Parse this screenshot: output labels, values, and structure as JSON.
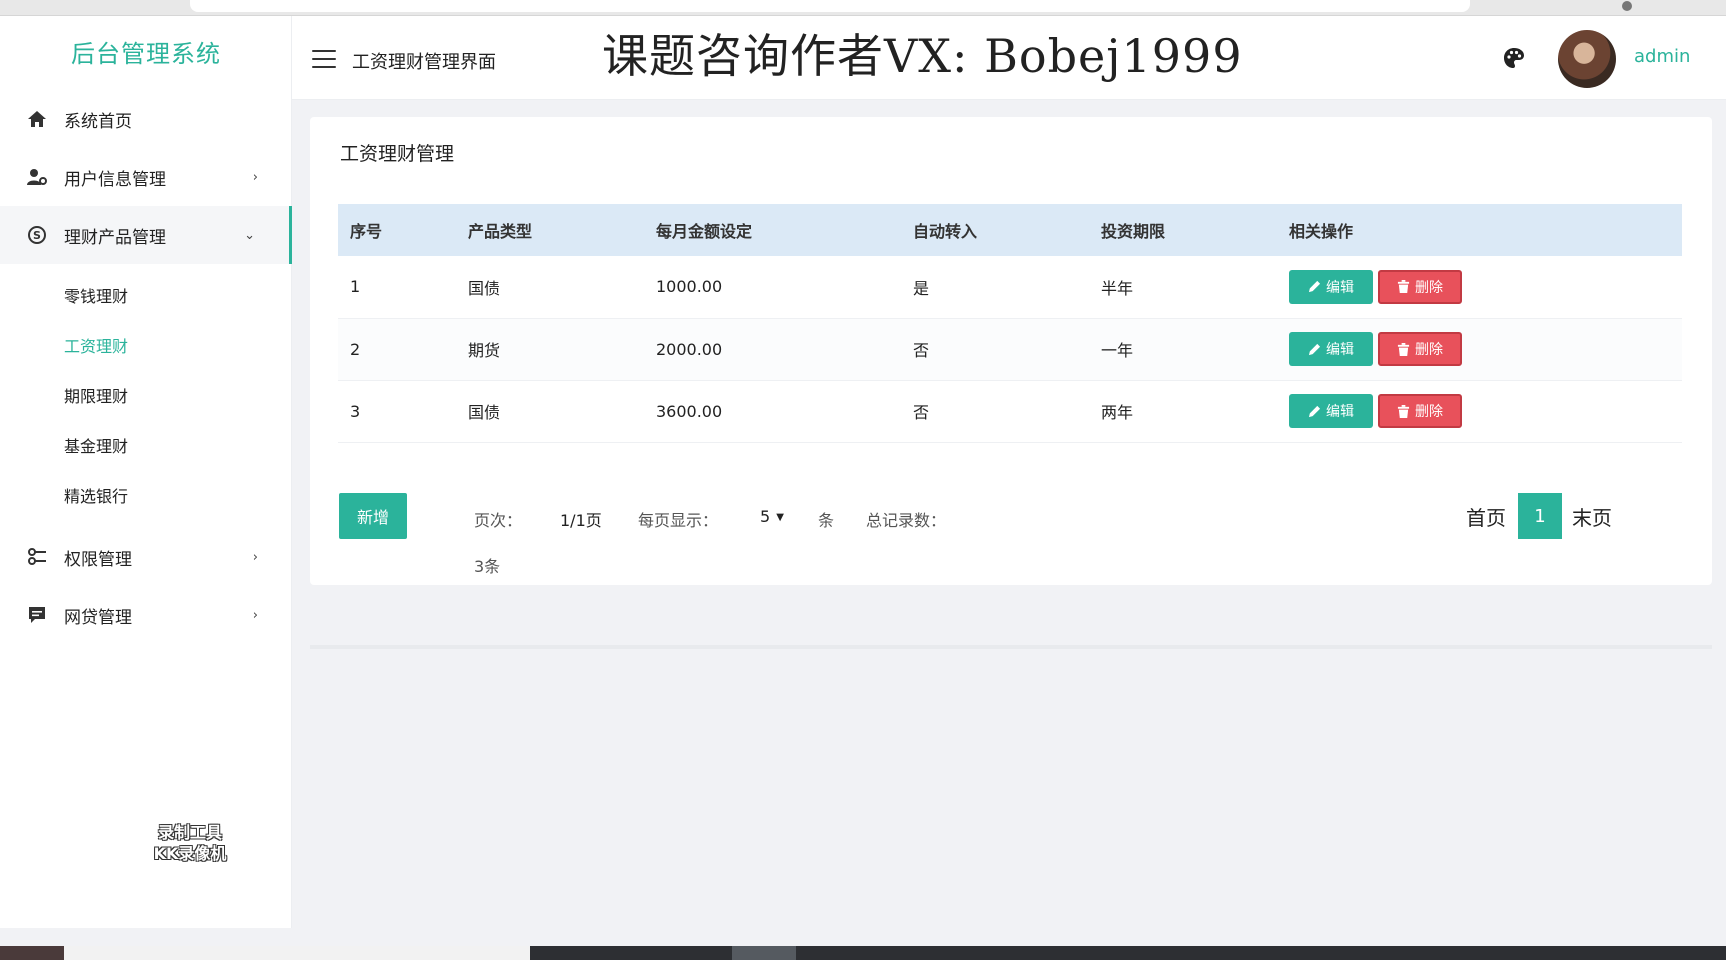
{
  "app": {
    "brand": "后台管理系统"
  },
  "sidebar": {
    "items": [
      {
        "label": "系统首页",
        "icon": "home-icon"
      },
      {
        "label": "用户信息管理",
        "icon": "user-settings-icon"
      },
      {
        "label": "理财产品管理",
        "icon": "skype-icon"
      },
      {
        "label": "权限管理",
        "icon": "key-icon"
      },
      {
        "label": "网贷管理",
        "icon": "message-icon"
      }
    ],
    "submenu": [
      {
        "label": "零钱理财"
      },
      {
        "label": "工资理财"
      },
      {
        "label": "期限理财"
      },
      {
        "label": "基金理财"
      },
      {
        "label": "精选银行"
      }
    ],
    "recorder_mark": {
      "line1": "录制工具",
      "line2": "KK录像机"
    }
  },
  "header": {
    "title": "工资理财管理界面",
    "watermark": "课题咨询作者VX: Bobej1999",
    "username": "admin",
    "accent": "#2bb39b"
  },
  "main": {
    "card_title": "工资理财管理",
    "table": {
      "columns": [
        "序号",
        "产品类型",
        "每月金额设定",
        "自动转入",
        "投资期限",
        "相关操作"
      ],
      "rows": [
        {
          "id": "1",
          "type": "国债",
          "amount": "1000.00",
          "auto": "是",
          "term": "半年"
        },
        {
          "id": "2",
          "type": "期货",
          "amount": "2000.00",
          "auto": "否",
          "term": "一年"
        },
        {
          "id": "3",
          "type": "国债",
          "amount": "3600.00",
          "auto": "否",
          "term": "两年"
        }
      ],
      "edit_label": "编辑",
      "delete_label": "删除"
    },
    "add_label": "新增",
    "pager": {
      "page_label": "页次：",
      "page_value": "1/1页",
      "per_page_label": "每页显示：",
      "per_page_value": "5",
      "per_page_unit": "条",
      "total_label": "总记录数：",
      "total_value": "3条",
      "first_label": "首页",
      "current_page": "1",
      "last_label": "末页"
    }
  }
}
